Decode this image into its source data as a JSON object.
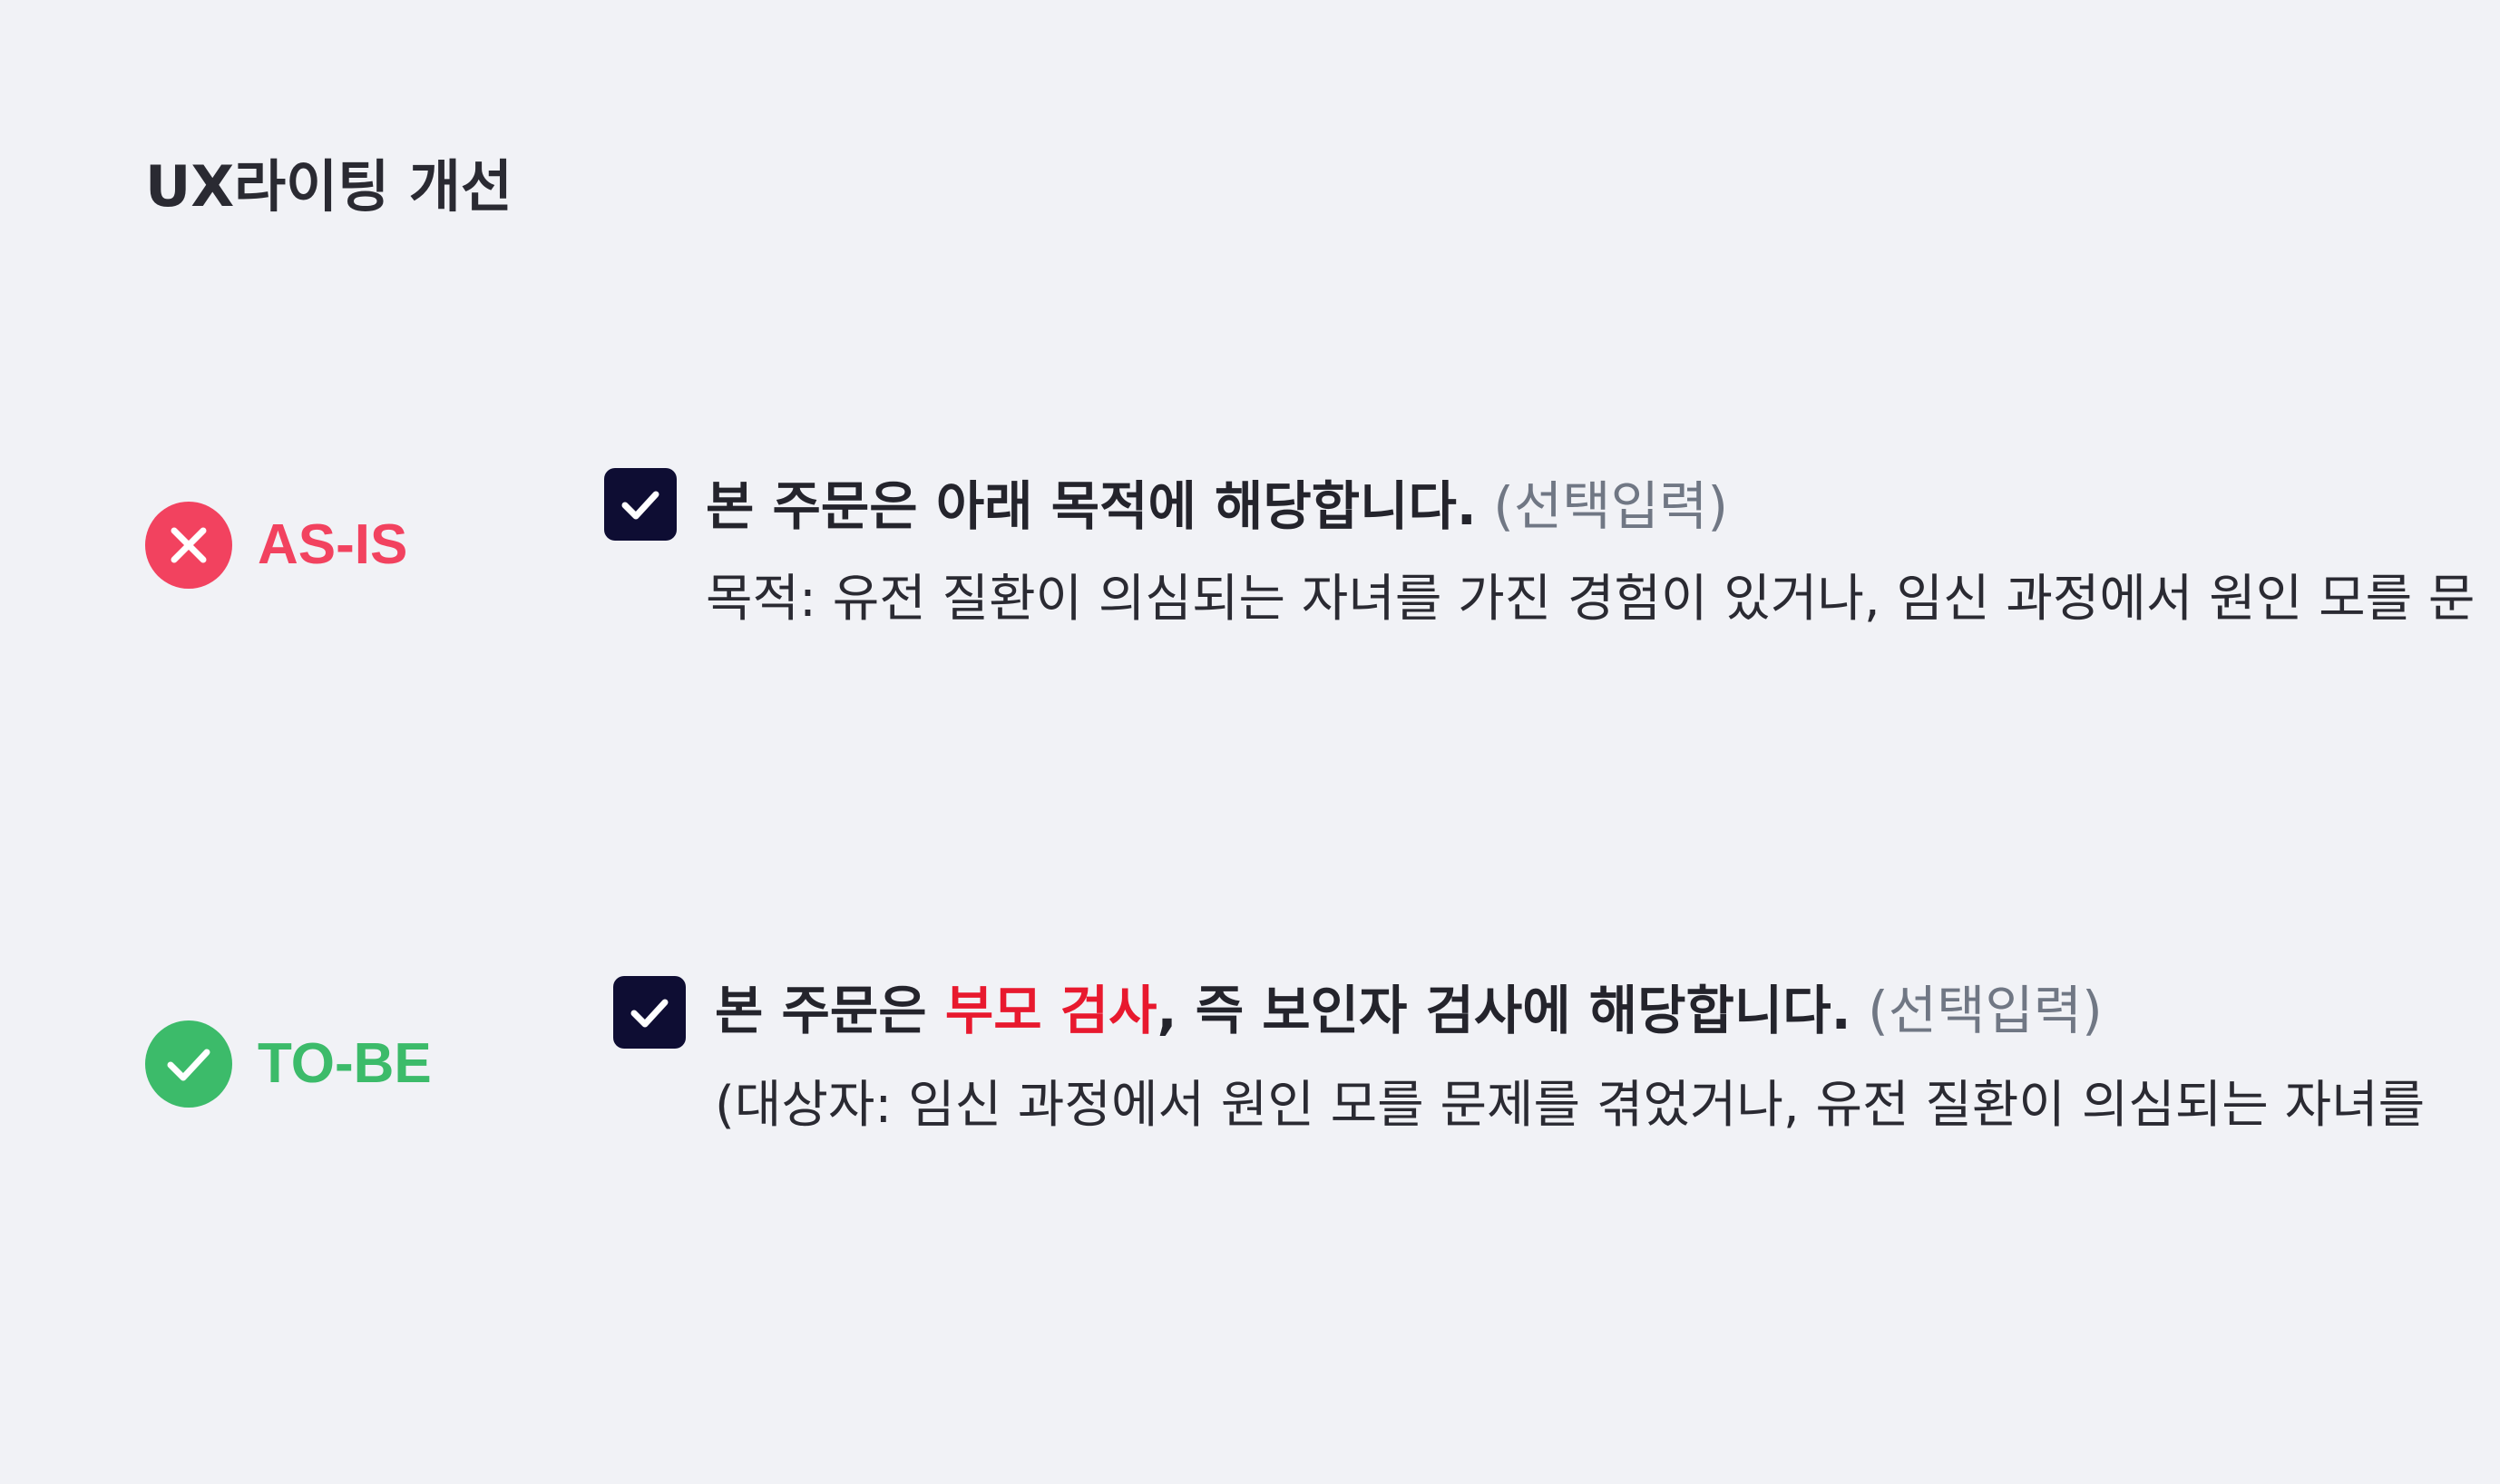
{
  "page": {
    "title": "UX라이팅 개선"
  },
  "colors": {
    "asis": "#f2425f",
    "tobe": "#3cbb6a",
    "checkbox": "#0e0d33",
    "highlight": "#e8192e",
    "optional": "#707784"
  },
  "asis": {
    "label": "AS-IS",
    "icon": "x-icon",
    "checkbox_checked": true,
    "main_text": "본 주문은 아래 목적에 해당합니다.",
    "optional_text": "(선택입력)",
    "sub_text": "목적: 유전 질환이 의심되는 자녀를 가진 경험이 있거나, 임신 과정에서 원인 모를 문"
  },
  "tobe": {
    "label": "TO-BE",
    "icon": "check-icon",
    "checkbox_checked": true,
    "main_prefix": "본 주문은 ",
    "main_highlight": "부모 검사",
    "main_suffix": ", 즉 보인자 검사에 해당합니다.",
    "optional_text": "(선택입력)",
    "sub_text": "(대상자: 임신 과정에서 원인 모를 문제를 겪었거나, 유전 질환이 의심되는 자녀를"
  }
}
